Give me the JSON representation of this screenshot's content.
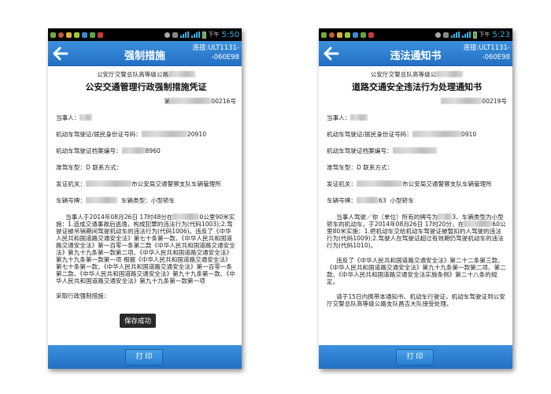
{
  "left": {
    "status": {
      "time": "5:50",
      "ampm": "下午"
    },
    "title": "强制措施",
    "connection": {
      "line1": "连接:ULT1131-",
      "line2": "-060E98"
    },
    "agency": "公安厅交警总队高等级公路",
    "doc_title": "公安交通管理行政强制措施凭证",
    "doc_no_prefix": "第",
    "doc_no_suffix": "00216号",
    "party_label": "当事人：",
    "license_label": "机动车驾驶证/居民身份证号码：",
    "license_tail": "20910",
    "archive_label": "机动车驾驶证档案编号：",
    "archive_tail": "8960",
    "vehicle_class": "准驾车型：D   联系方式：",
    "issuer_label": "发证机关：",
    "issuer_value": "市公安局交通警察支队车辆管理所",
    "plate_label": "车辆号牌：",
    "plate_type": "车辆类型：小型轿车",
    "paragraph_a": "当事人于2014年08月26日 17时48分在",
    "paragraph_a2": "0公里90米实施：1.造成交通事故后逃逸，构成犯罪的违法行为(代码1003);2.驾驶证被吊销期间驾驶机动车的违法行为(代码1006)。违反了《中华人民共和国道路交通安全法》第七十条第一款、《中华人民共和国道路交通安全法》第一百零一条第二款《中华人民共和国道路交通安全法》第九十九条第一款第二项、《中华人民共和国道路交通安全法》第九十九条第一款第一项 根据《中华人民共和国道路交通安全法》第七十条第一款、《中华人民共和国道路交通安全法》第一百零一条第二款、《中华人民共和国道路交通安全法》第九十九条第一款、《中华人民共和国道路交通安全法》第九十九条第一款第一项",
    "measures_label": "采取行政强制措施：",
    "toast": "保存成功",
    "print_label": "打   印"
  },
  "right": {
    "status": {
      "time": "5:23",
      "ampm": "下午"
    },
    "title": "违法通知书",
    "connection": {
      "line1": "连接:ULT1131-",
      "line2": "-060E98"
    },
    "agency": "公安厅交警总队高等级公",
    "doc_title": "道路交通安全违法行为处理通知书",
    "doc_no_suffix": "00219号",
    "party_label": "当事人：",
    "license_label": "机动车驾驶证/居民身份证号码：",
    "license_tail": "0910",
    "archive_label": "机动车驾驶证档案编号：",
    "vehicle_class": "准驾车型：D   联系方式：",
    "issuer_label": "发证机关：",
    "issuer_value": "市公安局交通警察支队车辆管理所",
    "plate_label": "车辆号牌：",
    "plate_mid": "63",
    "plate_type": "小型轿车",
    "paragraph_a": "当事人驾驶／你（单位）所有的牌号为",
    "paragraph_a2": "3、车辆类型为小型轿车的机动车，于2014年08月26日 17时20分，在",
    "paragraph_a3": "60公里80米实施：1.把机动车交给机动车驾驶证被暂扣的人驾驶的违法行为(代码1009);2.驾驶人在驾驶证超过有效期仍驾驶机动车的违法行为(代码1010)。",
    "paragraph_b": "违反了《中华人民共和国道路交通安全法》第二十二条第三款、《中华人民共和国道路交通安全法》第九十九条第一款第二项、第二款、《中华人民共和国道路交通安全法实施条例》第二十八条的规定。",
    "paragraph_c": "请于15日内携带本通知书、机动车行驶证，机动车驾驶证到公安厅交警总队高等级公路支队昌吉大队接受处理。",
    "print_label": "打   印"
  },
  "colors": {
    "titlebar": "#2a7fd0",
    "status_time": "#33b5e5",
    "statusbar": "#000000"
  }
}
